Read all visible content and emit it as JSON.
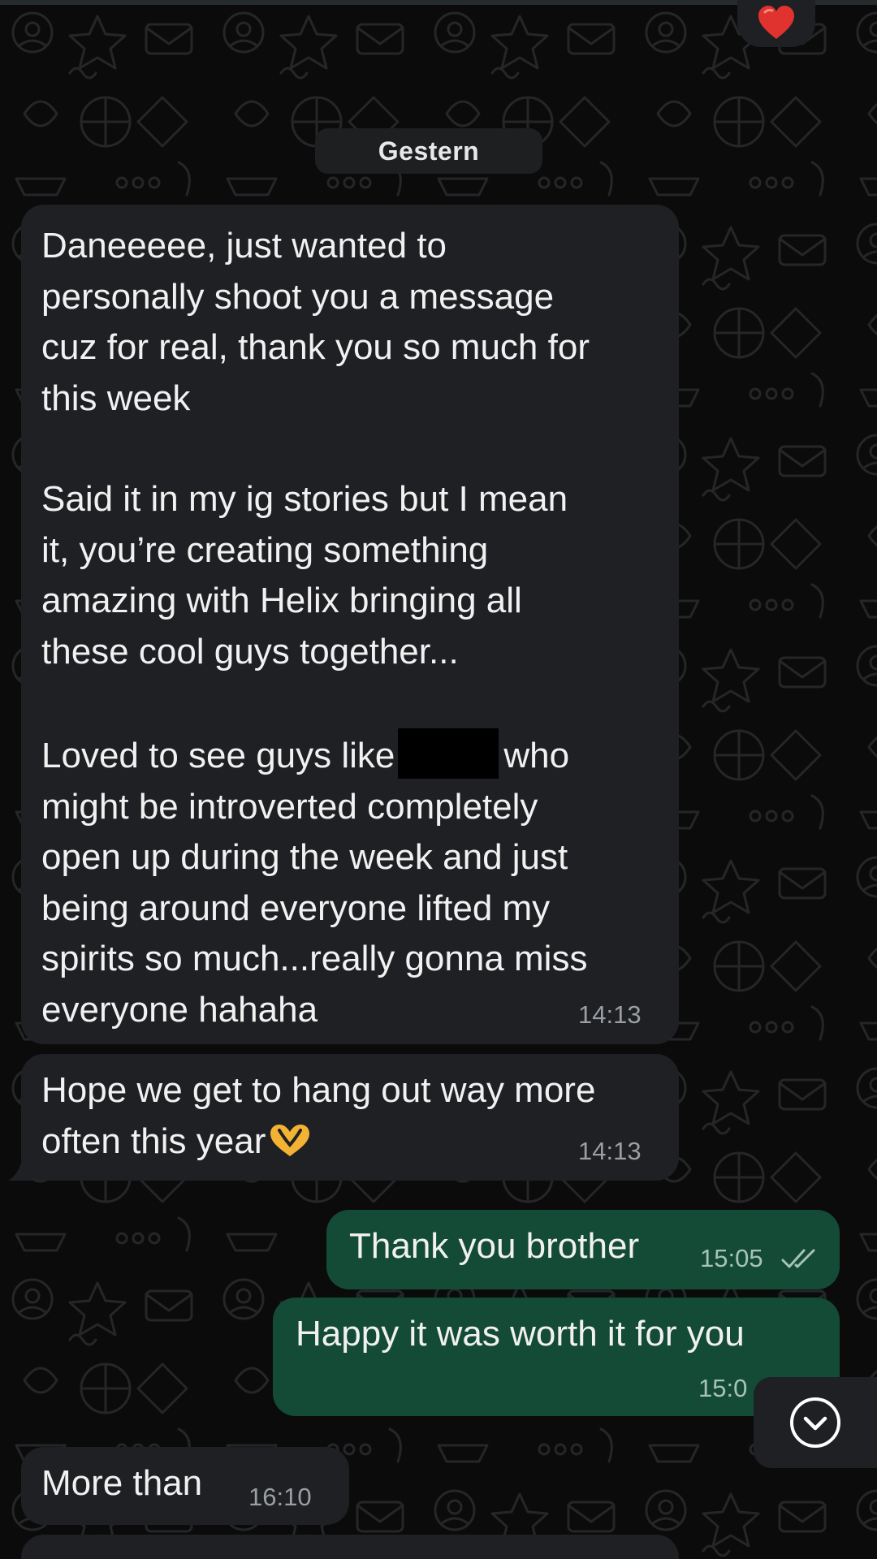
{
  "date_separator": "Gestern",
  "reaction_emoji": "heart",
  "messages": [
    {
      "direction": "incoming",
      "paragraphs": [
        "Daneeeee, just wanted to\npersonally shoot you a message\ncuz for real, thank you so much for\nthis week",
        "Said it in my ig stories but I mean\nit, you’re creating something\namazing with Helix bringing all\nthese cool guys together...",
        "Loved to see guys like",
        "who\nmight be introverted completely\nopen up during the week and just\nbeing around everyone lifted my\nspirits so much...really gonna miss\neveryone hahaha"
      ],
      "time": "14:13"
    },
    {
      "direction": "incoming",
      "text": "Hope we get to hang out way more\noften this year",
      "emoji": "heart-hands",
      "time": "14:13"
    },
    {
      "direction": "outgoing",
      "text": "Thank you brother",
      "time": "15:05",
      "status": "read"
    },
    {
      "direction": "outgoing",
      "text": "Happy it was worth it for you",
      "time": "15:0"
    },
    {
      "direction": "incoming",
      "text": "More than",
      "time": "16:10"
    }
  ],
  "colors": {
    "background": "#0b0b0b",
    "incoming_bubble": "#1f2023",
    "outgoing_bubble": "#144b37",
    "read_ticks": "#a8c3b6",
    "timestamp": "#9b9fa3",
    "heart": "#e0322f"
  },
  "scroll_down_icon": "chevron-down-circle-icon"
}
